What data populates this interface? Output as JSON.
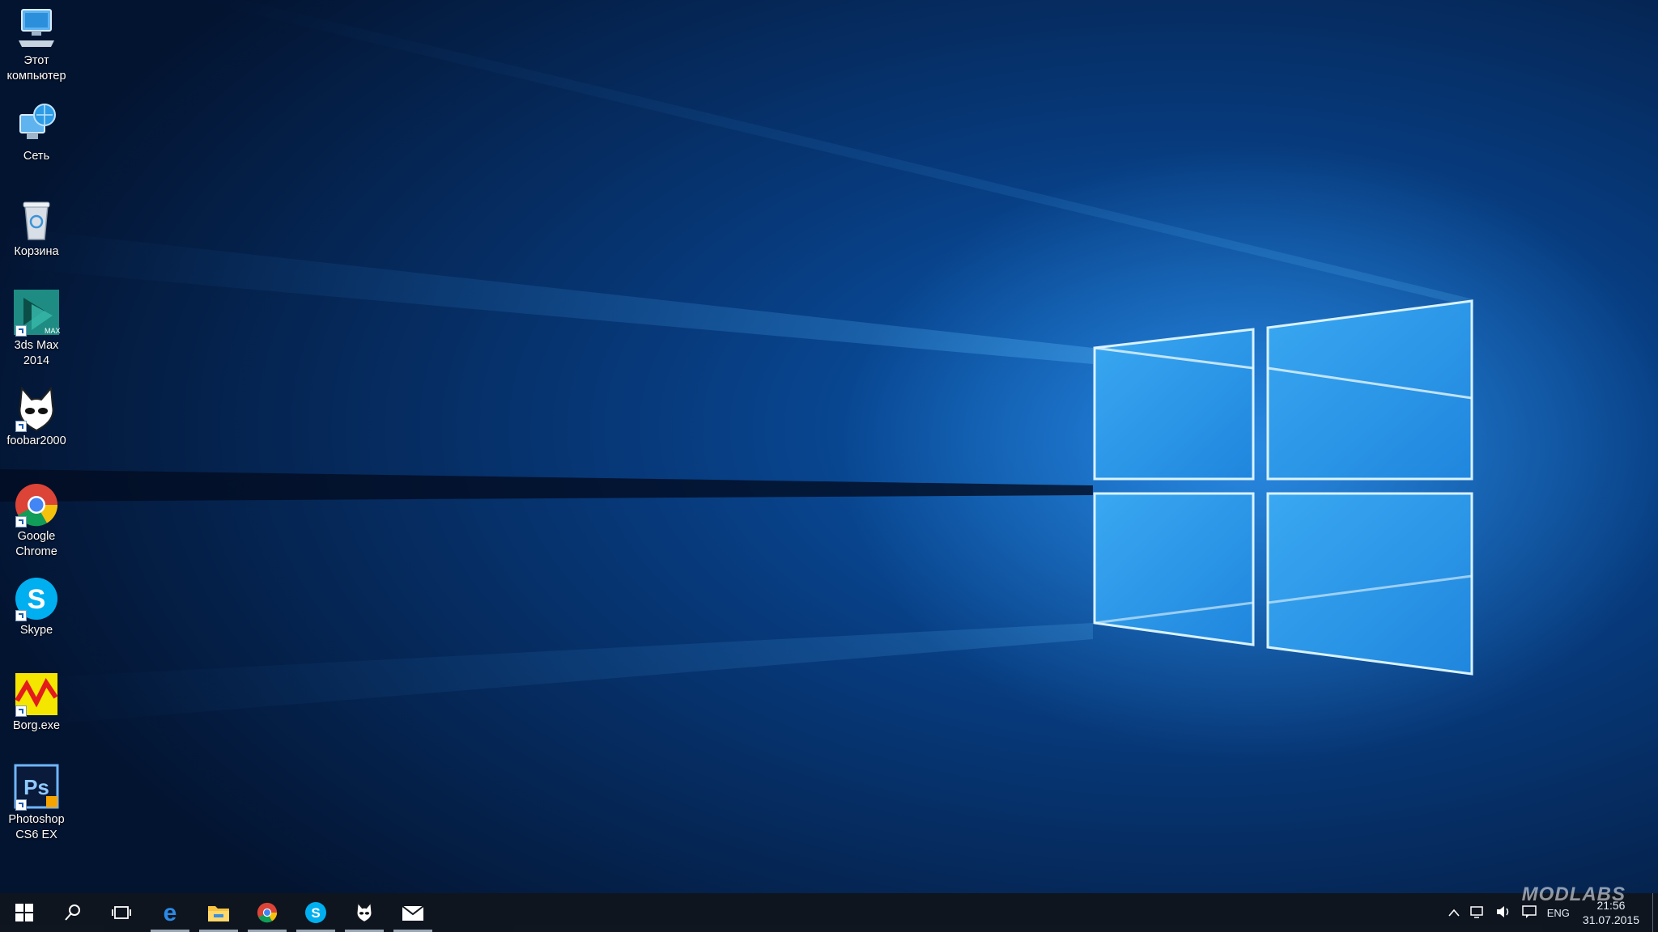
{
  "desktop": {
    "icons": [
      {
        "label": "Этот компьютер",
        "icon": "computer-icon"
      },
      {
        "label": "Сеть",
        "icon": "network-icon"
      },
      {
        "label": "Корзина",
        "icon": "recycle-bin-icon"
      },
      {
        "label": "3ds Max 2014",
        "icon": "3ds-max-icon",
        "badge": "MAX"
      },
      {
        "label": "foobar2000",
        "icon": "foobar2000-icon"
      },
      {
        "label": "Google Chrome",
        "icon": "chrome-icon"
      },
      {
        "label": "Skype",
        "icon": "skype-icon",
        "glyph": "S"
      },
      {
        "label": "Borg.exe",
        "icon": "borg-icon"
      },
      {
        "label": "Photoshop CS6 EX",
        "icon": "photoshop-icon",
        "glyph": "Ps"
      }
    ]
  },
  "taskbar": {
    "start": "windows-start-icon",
    "search": "search-icon",
    "task_view": "task-view-icon",
    "pinned": [
      {
        "name": "edge-icon",
        "glyph": "e"
      },
      {
        "name": "file-explorer-icon"
      },
      {
        "name": "chrome-icon"
      },
      {
        "name": "skype-icon",
        "glyph": "S"
      },
      {
        "name": "foobar2000-icon"
      },
      {
        "name": "mail-icon"
      }
    ],
    "tray": {
      "language": "ENG",
      "time": "21:56",
      "date": "31.07.2015"
    }
  },
  "watermark": "MODLABS",
  "colors": {
    "accent": "#1e88e5",
    "taskbar": "#10161e",
    "light": "#bfe6ff"
  }
}
